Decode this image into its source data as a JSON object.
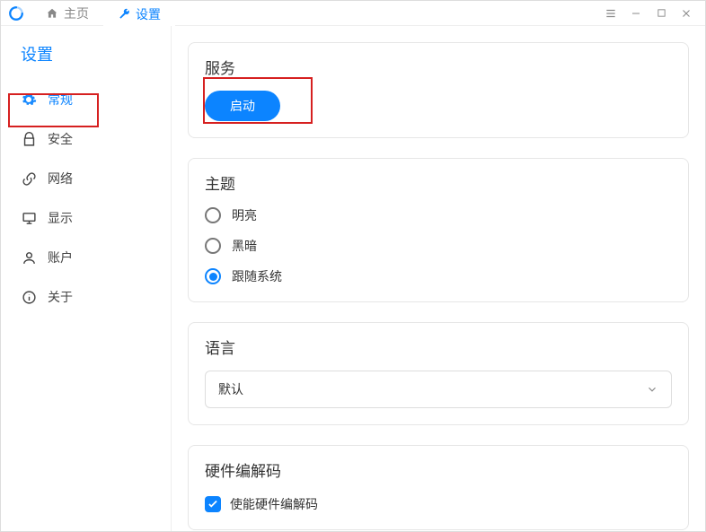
{
  "titlebar": {
    "tabs": [
      {
        "label": "主页"
      },
      {
        "label": "设置"
      }
    ]
  },
  "sidebar": {
    "title": "设置",
    "items": [
      {
        "label": "常规"
      },
      {
        "label": "安全"
      },
      {
        "label": "网络"
      },
      {
        "label": "显示"
      },
      {
        "label": "账户"
      },
      {
        "label": "关于"
      }
    ]
  },
  "panels": {
    "service": {
      "title": "服务",
      "button": "启动"
    },
    "theme": {
      "title": "主题",
      "options": [
        {
          "label": "明亮"
        },
        {
          "label": "黑暗"
        },
        {
          "label": "跟随系统"
        }
      ],
      "selected": 2
    },
    "language": {
      "title": "语言",
      "value": "默认"
    },
    "hwcodec": {
      "title": "硬件编解码",
      "checkbox_label": "使能硬件编解码",
      "checked": true
    }
  }
}
